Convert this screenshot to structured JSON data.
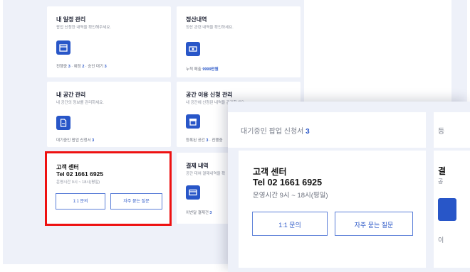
{
  "cards": {
    "schedule": {
      "title": "내 일정 관리",
      "desc": "팝업 신청한 내역을 확인해주세요.",
      "icon": "calendar-icon",
      "stat_pre": "진행중",
      "stat_a": "3",
      "stat_mid1": " · 예정",
      "stat_b": "2",
      "stat_mid2": " · 승인 대기",
      "stat_c": "3"
    },
    "settlement": {
      "title": "정산내역",
      "desc": "정산 관련 내역을 확인하세요.",
      "icon": "money-icon",
      "stat_pre": "누적 매출",
      "stat_a": "9999만원"
    },
    "space": {
      "title": "내 공간 관리",
      "desc": "내 공간의 정보를 관리하세요.",
      "icon": "document-icon",
      "stat_pre": "대기중인 팝업 신청서",
      "stat_a": "3"
    },
    "usage": {
      "title": "공간 이용 신청 관리",
      "desc": "내 공간에 신청된 내역을 관리하세요.",
      "icon": "store-icon",
      "stat_pre": "등록된 공간",
      "stat_a": "3",
      "stat_mid1": " · 진행중"
    },
    "support": {
      "title": "고객 센터",
      "tel": "Tel 02 1661 6925",
      "hours": "운영시간 9시 ~ 18시(평일)",
      "inquiry_btn": "1:1 문의",
      "faq_btn": "자주 묻는 질문"
    },
    "payment": {
      "title": "결제 내역",
      "desc": "공간 대여 결제내역을 확",
      "icon": "card-icon",
      "stat_pre": "이번달 결제건",
      "stat_a": "3"
    }
  },
  "zoom": {
    "waiting_label": "대기중인 팝업 신청서",
    "waiting_count": "3",
    "peek_top": "등",
    "title": "고객 센터",
    "tel": "Tel 02 1661 6925",
    "hours": "운영시간 9시 ~ 18시(평일)",
    "inquiry_btn": "1:1 문의",
    "faq_btn": "자주 묻는 질문",
    "peek_title": "결",
    "peek_desc": "공",
    "peek_bottom": "이"
  },
  "colors": {
    "accent": "#2856c8",
    "highlight": "#ee1111",
    "background": "#eef1f9"
  }
}
